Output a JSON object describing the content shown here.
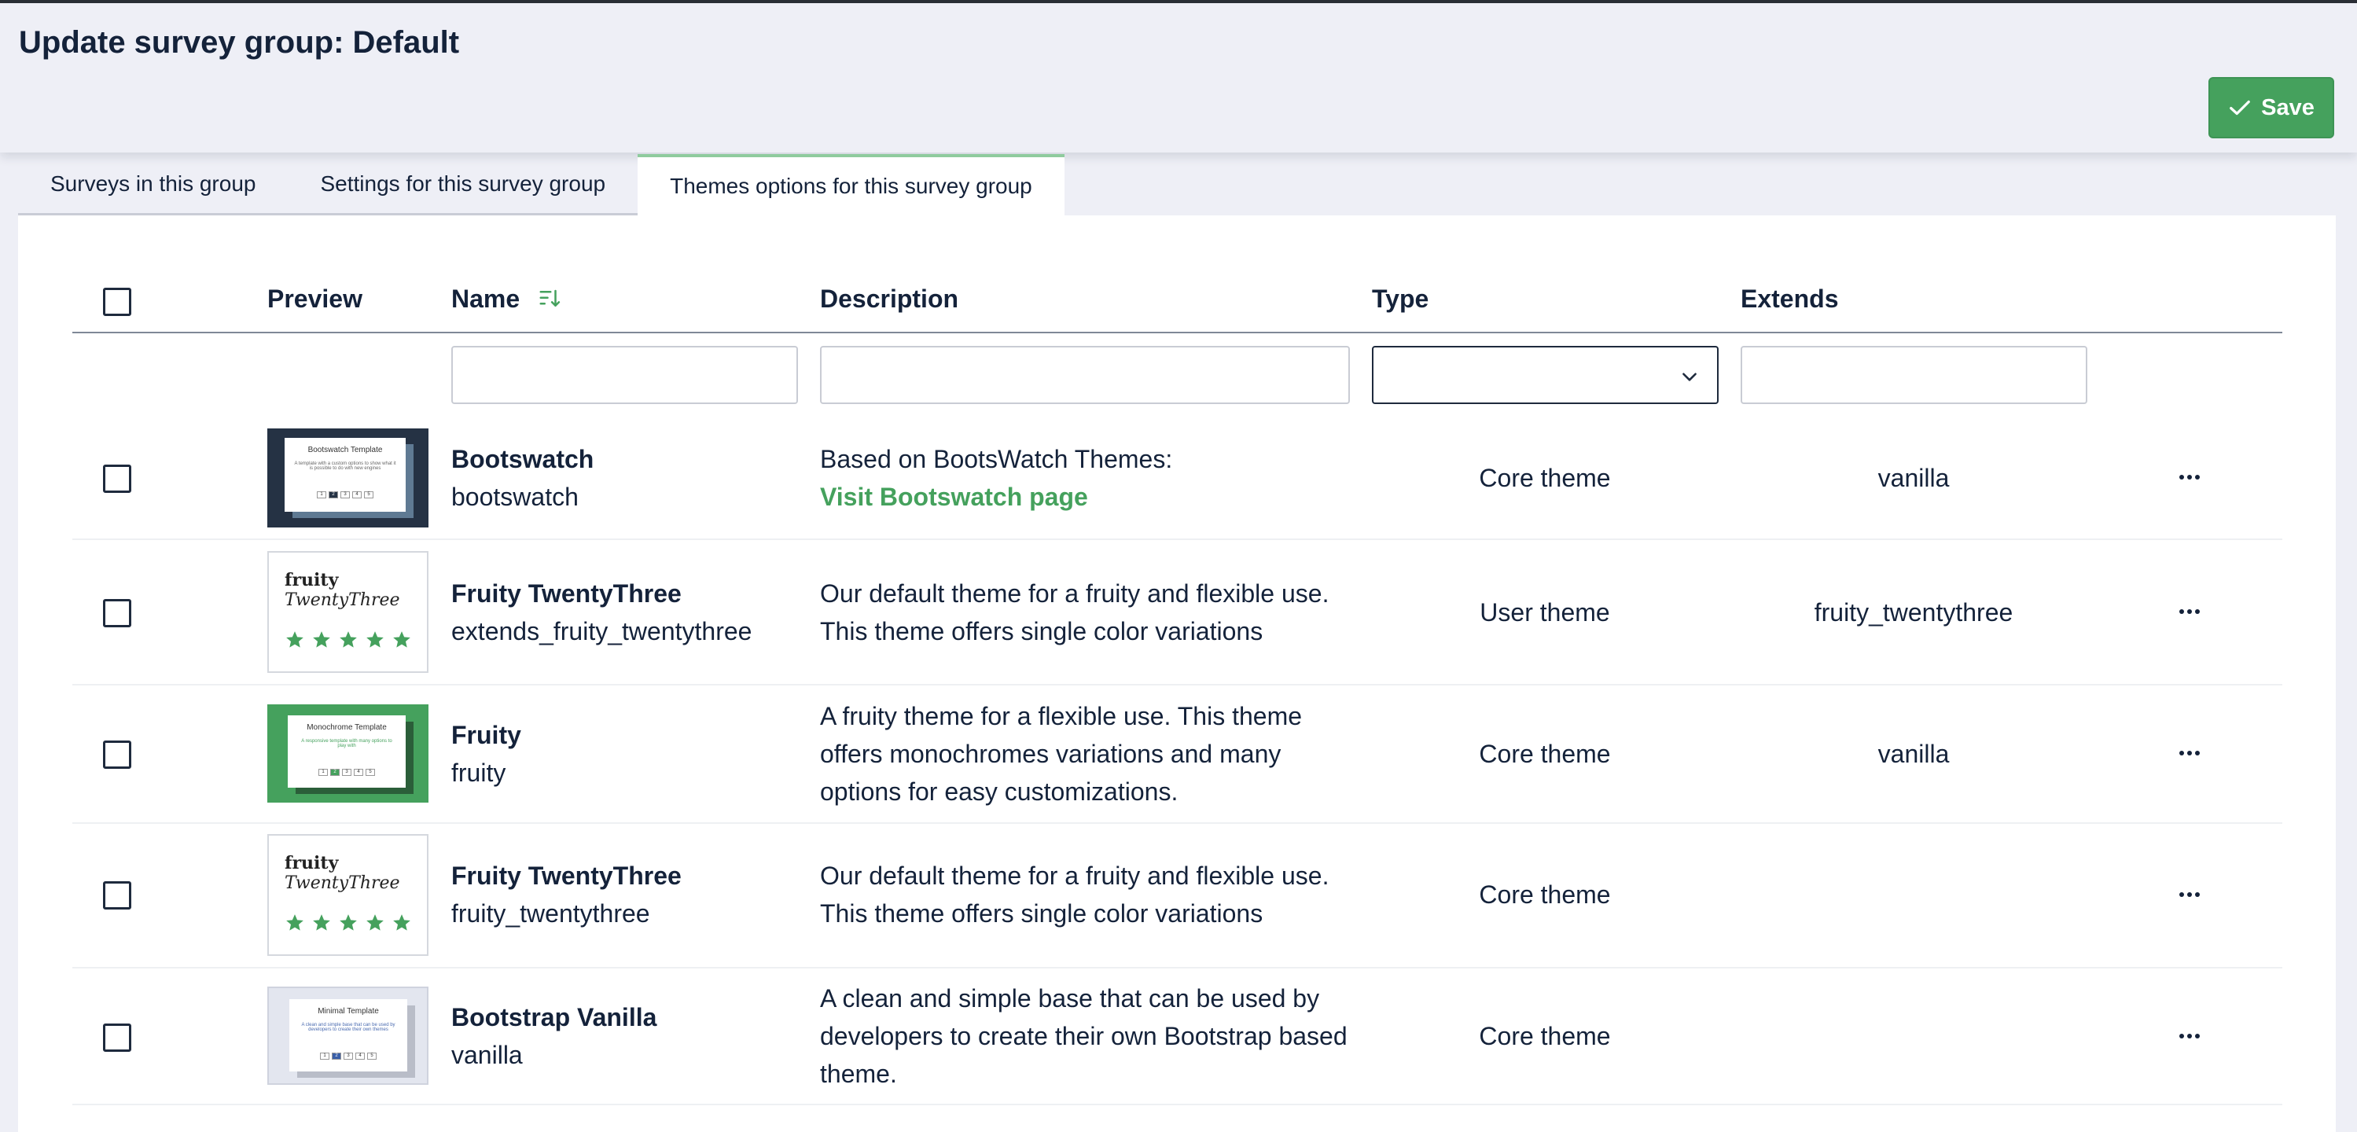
{
  "page": {
    "title": "Update survey group: Default",
    "save_label": "Save"
  },
  "tabs": [
    {
      "label": "Surveys in this group",
      "active": false
    },
    {
      "label": "Settings for this survey group",
      "active": false
    },
    {
      "label": "Themes options for this survey group",
      "active": true
    }
  ],
  "table": {
    "columns": [
      "Preview",
      "Name",
      "Description",
      "Type",
      "Extends"
    ],
    "filters": {
      "name": "",
      "description": "",
      "type": "",
      "extends": ""
    },
    "rows": [
      {
        "name": "Bootswatch",
        "key": "bootswatch",
        "description": "Based on BootsWatch Themes:",
        "link": "Visit Bootswatch page",
        "type": "Core theme",
        "extends": "vanilla",
        "preview": {
          "title": "Bootswatch Template",
          "text": "A template with a custom options to show what it is possible to do with new engines",
          "pages": [
            "1",
            "2",
            "3",
            "4",
            "5"
          ]
        }
      },
      {
        "name": "Fruity TwentyThree",
        "key": "extends_fruity_twentythree",
        "description": "Our default theme for a fruity and flexible use. This theme offers single color variations",
        "type": "User theme",
        "extends": "fruity_twentythree",
        "preview": {
          "line1": "fruity",
          "line2": "TwentyThree"
        }
      },
      {
        "name": "Fruity",
        "key": "fruity",
        "description": "A fruity theme for a flexible use. This theme offers monochromes variations and many options for easy customizations.",
        "type": "Core theme",
        "extends": "vanilla",
        "preview": {
          "title": "Monochrome Template",
          "text": "A responsive template with many options to play with",
          "pages": [
            "1",
            "2",
            "3",
            "4",
            "5"
          ]
        }
      },
      {
        "name": "Fruity TwentyThree",
        "key": "fruity_twentythree",
        "description": "Our default theme for a fruity and flexible use. This theme offers single color variations",
        "type": "Core theme",
        "extends": "",
        "preview": {
          "line1": "fruity",
          "line2": "TwentyThree"
        }
      },
      {
        "name": "Bootstrap Vanilla",
        "key": "vanilla",
        "description": "A clean and simple base that can be used by developers to create their own Bootstrap based theme.",
        "type": "Core theme",
        "extends": "",
        "preview": {
          "title": "Minimal Template",
          "text": "A clean and simple base that can be used by developers to create their own themes",
          "pages": [
            "1",
            "2",
            "3",
            "4",
            "5"
          ]
        }
      }
    ]
  },
  "colors": {
    "accent_green": "#45a15d",
    "dark_navy": "#14223a",
    "bootswatch_bg": "#253244"
  },
  "icons": [
    "check-icon",
    "sort-icon",
    "chevron-down-icon",
    "more-icon",
    "star-icon"
  ]
}
